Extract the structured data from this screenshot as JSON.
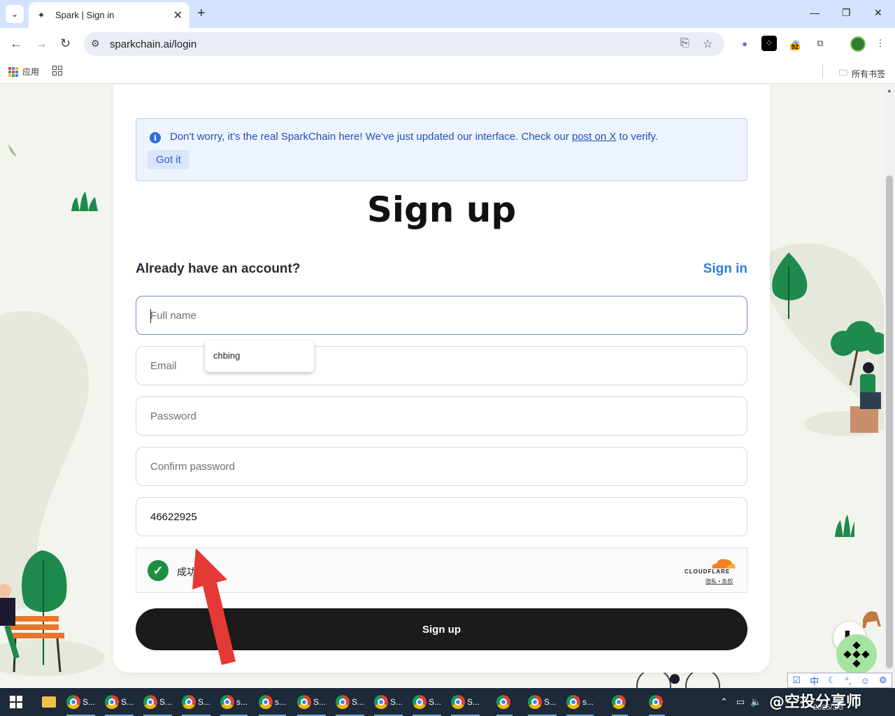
{
  "browser": {
    "tab_title": "Spark | Sign in",
    "url": "sparkchain.ai/login",
    "extension_badge": "92",
    "bookmarks": {
      "apps_label": "应用",
      "all_bookmarks_label": "所有书签"
    }
  },
  "notice": {
    "message_before": "Don't worry, it's the real SparkChain here! We've just updated our interface. Check our ",
    "link_text": "post on X",
    "message_after": " to verify.",
    "dismiss_label": "Got it"
  },
  "form": {
    "title": "Sign up",
    "already_text": "Already have an account?",
    "signin_label": "Sign in",
    "full_name_placeholder": "Full name",
    "email_placeholder": "Email",
    "password_placeholder": "Password",
    "confirm_placeholder": "Confirm password",
    "code_value": "46622925",
    "autocomplete_suggestion": "chbing",
    "captcha": {
      "status": "成功!",
      "brand": "CLOUDFLARE",
      "links": "隐私 • 条款"
    },
    "submit_label": "Sign up"
  },
  "taskbar": {
    "items": [
      "S...",
      "S...",
      "S...",
      "S...",
      "s...",
      "s...",
      "S...",
      "S...",
      "S...",
      "S...",
      "S...",
      "",
      "S...",
      "s...",
      "",
      ""
    ],
    "watermark": "@空投分享师",
    "date": "2025/3/3"
  },
  "colors": {
    "accent": "#2f80d6",
    "notice_text": "#1f4fb5",
    "submit_bg": "#1b1b1b",
    "success": "#1e8e3e",
    "arrow": "#e53935"
  }
}
